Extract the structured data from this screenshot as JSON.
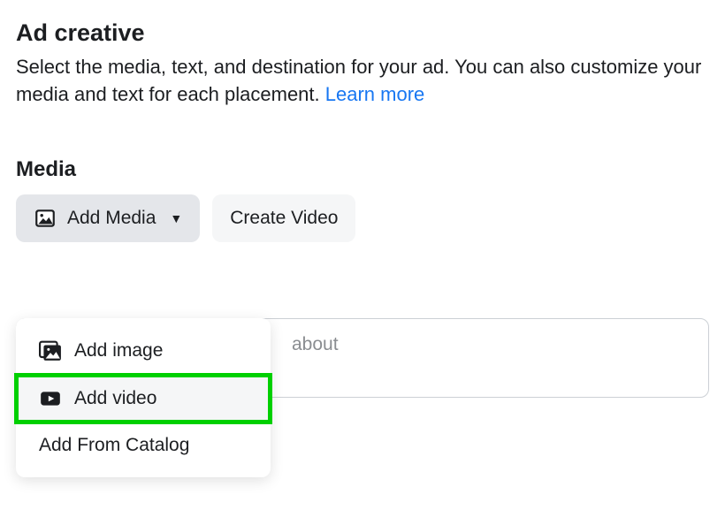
{
  "header": {
    "title": "Ad creative",
    "description_part1": "Select the media, text, and destination for your ad. You can also customize your media and text for each placement. ",
    "learn_more": "Learn more"
  },
  "media": {
    "section_label": "Media",
    "add_media_label": "Add Media",
    "create_video_label": "Create Video",
    "dropdown": {
      "add_image": "Add image",
      "add_video": "Add video",
      "add_from_catalog": "Add From Catalog"
    }
  },
  "primary_text": {
    "visible_placeholder_fragment": "about"
  }
}
